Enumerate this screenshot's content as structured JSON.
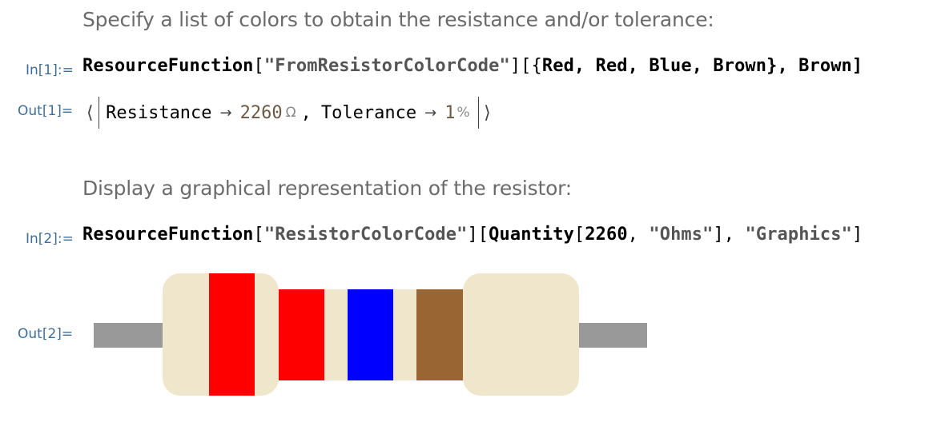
{
  "cell1": {
    "text": "Specify a list of colors to obtain the resistance and/or tolerance:",
    "in_label": "In[1]:=",
    "input": {
      "fn": "ResourceFunction",
      "br_open": "[",
      "name": "\"FromResistorColorCode\"",
      "mid": "][{",
      "args": "Red, Red, Blue, Brown",
      "tail": "}, Brown]"
    },
    "out_label": "Out[1]=",
    "output": {
      "open": "⟨",
      "key1": "Resistance",
      "arrow": "→",
      "val1": "2260",
      "unit1": "Ω",
      "sep": ",",
      "key2": "Tolerance",
      "val2": "1",
      "unit2": "%",
      "close": "⟩"
    }
  },
  "cell2": {
    "text": "Display a graphical representation of the resistor:",
    "in_label": "In[2]:=",
    "input": {
      "fn": "ResourceFunction",
      "br_open": "[",
      "name": "\"ResistorColorCode\"",
      "mid": "][",
      "fn2": "Quantity",
      "args_open": "[",
      "num": "2260",
      "comma": ", ",
      "unit": "\"Ohms\"",
      "args_close": "], ",
      "opt": "\"Graphics\"",
      "tail": "]"
    },
    "out_label": "Out[2]="
  },
  "resistor": {
    "body_color": "#efe6cb",
    "lead_color": "#999999",
    "bands": [
      {
        "name": "Red",
        "color": "#ff0000"
      },
      {
        "name": "Red",
        "color": "#ff0000"
      },
      {
        "name": "Blue",
        "color": "#0000ff"
      },
      {
        "name": "Brown",
        "color": "#996633"
      }
    ]
  }
}
